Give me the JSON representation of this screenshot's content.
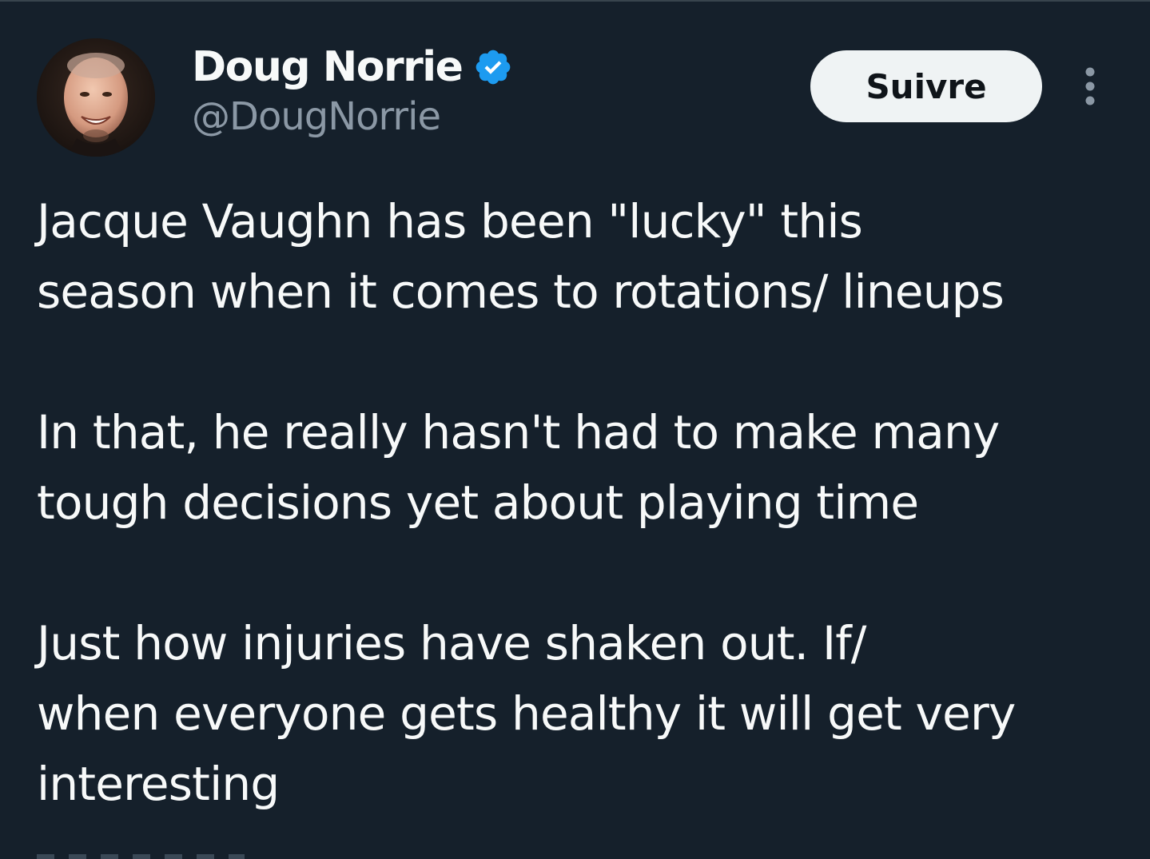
{
  "author": {
    "display_name": "Doug Norrie",
    "handle": "@DougNorrie",
    "verified": true,
    "verified_color": "#1d9bf0"
  },
  "actions": {
    "follow_label": "Suivre",
    "more_icon": "more-vertical-icon"
  },
  "tweet": {
    "paragraphs": [
      {
        "lines": [
          "Jacque Vaughn has been \"lucky\" this",
          "season when it comes to rotations/ lineups"
        ]
      },
      {
        "lines": [
          "In that, he really hasn't had to make many",
          "tough decisions yet about playing time"
        ]
      },
      {
        "lines": [
          "Just how injuries have shaken out. If/",
          "when everyone gets healthy it will get very",
          "interesting"
        ]
      }
    ]
  },
  "colors": {
    "background": "#15202b",
    "text": "#f7f9f9",
    "secondary_text": "#8b98a5",
    "button_bg": "#eff3f4",
    "button_text": "#0f1419"
  }
}
